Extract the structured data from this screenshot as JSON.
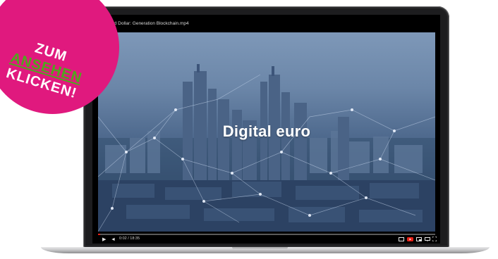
{
  "video": {
    "title": "Euro and Dollar: Generation Blockchain.mp4",
    "overlay_text": "Digital euro",
    "progress_fraction": 0.007,
    "time_readout": "0:02 / 18:35"
  },
  "controls": {
    "left_icons": [
      "play-icon",
      "volume-icon"
    ],
    "right_icons": [
      "subtitles-icon",
      "youtube-icon",
      "settings-icon",
      "miniplayer-icon",
      "fullscreen-icon"
    ]
  },
  "badge": {
    "line1": "ZUM",
    "line2": "ANSEHEN",
    "line3": "KLICKEN!",
    "color": "#e0197e",
    "accent": "#4ea81d"
  }
}
